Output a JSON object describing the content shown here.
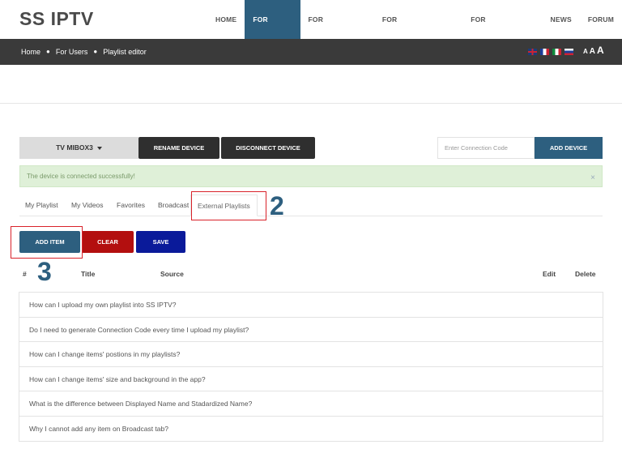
{
  "header": {
    "logo": "SS IPTV",
    "nav": [
      "HOME",
      "FOR USERS",
      "FOR OPERATORS",
      "FOR BROADCASTERS",
      "FOR ADVERTISERS",
      "NEWS",
      "FORUM"
    ],
    "active_nav": "FOR USERS"
  },
  "breadcrumb": [
    "Home",
    "For Users",
    "Playlist editor"
  ],
  "font_size_controls": [
    "A",
    "A",
    "A"
  ],
  "languages": [
    "uk-flag",
    "fr-flag",
    "it-flag",
    "ru-flag"
  ],
  "device": {
    "selected": "TV MIBOX3",
    "rename_label": "RENAME DEVICE",
    "disconnect_label": "DISCONNECT DEVICE",
    "code_placeholder": "Enter Connection Code",
    "add_label": "ADD DEVICE"
  },
  "alert": {
    "message": "The device is connected successfully!",
    "close": "×"
  },
  "tabs": [
    "My Playlist",
    "My Videos",
    "Favorites",
    "Broadcast",
    "External Playlists"
  ],
  "active_tab": "External Playlists",
  "annotations": {
    "step2": "2",
    "step3": "3"
  },
  "actions": {
    "add_item": "ADD ITEM",
    "clear": "CLEAR",
    "save": "SAVE"
  },
  "table": {
    "columns": [
      "#",
      "Title",
      "Source",
      "Edit",
      "Delete"
    ]
  },
  "faq": [
    "How can I upload my own playlist into SS IPTV?",
    "Do I need to generate Connection Code every time I upload my playlist?",
    "How can I change items' postions in my playlists?",
    "How can I change items' size and background in the app?",
    "What is the difference between Displayed Name and Stadardized Name?",
    "Why I cannot add any item on Broadcast tab?"
  ],
  "colors": {
    "primary": "#2d5f7f",
    "dark": "#2f2f2f",
    "danger": "#b30f0f",
    "save": "#0a1a9a",
    "highlight": "#d9222a",
    "alert_bg": "#dff0d8"
  }
}
